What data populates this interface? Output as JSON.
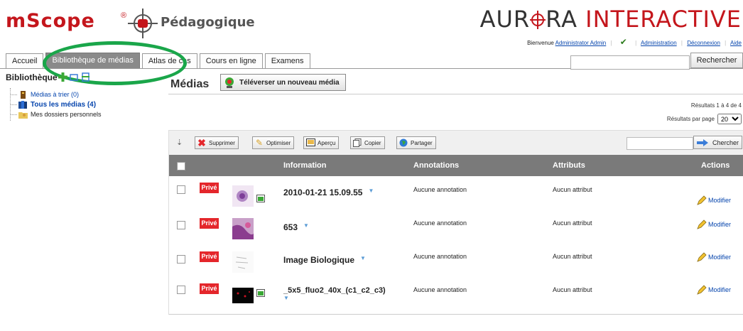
{
  "header": {
    "logo": "mScope",
    "logo_reg": "®",
    "logo_subtitle": "Pédagogique",
    "brand_left": "AUR",
    "brand_mid": "RA",
    "brand_right": "INTERACTIVE",
    "welcome": "Bienvenue",
    "user": "Administrator Admin",
    "admin_link": "Administration",
    "logout_link": "Déconnexion",
    "help_link": "Aide"
  },
  "tabs": [
    {
      "label": "Accueil"
    },
    {
      "label": "Bibliothèque de médias"
    },
    {
      "label": "Atlas de cas"
    },
    {
      "label": "Cours en ligne"
    },
    {
      "label": "Examens"
    }
  ],
  "search_button": "Rechercher",
  "sidebar": {
    "title": "Bibliothèque",
    "items": [
      {
        "label": "Médias à trier (0)"
      },
      {
        "label": "Tous les médias (4)"
      },
      {
        "label": "Mes dossiers personnels"
      }
    ]
  },
  "main": {
    "title": "Médias",
    "upload_label": "Téléverser un nouveau média",
    "results": "Résultats 1 à 4 de 4",
    "per_page_label": "Résultats par page",
    "per_page_value": "20"
  },
  "toolbar": {
    "delete": "Supprimer",
    "optimize": "Optimiser",
    "preview": "Aperçu",
    "copy": "Copier",
    "share": "Partager",
    "search": "Chercher"
  },
  "table": {
    "columns": [
      "Information",
      "Annotations",
      "Attributs",
      "Actions"
    ],
    "rows": [
      {
        "badge": "Privé",
        "info": "2010-01-21 15.09.55",
        "annotations": "Aucune annotation",
        "attributes": "Aucun attribut",
        "action": "Modifier"
      },
      {
        "badge": "Privé",
        "info": "653",
        "annotations": "Aucune annotation",
        "attributes": "Aucun attribut",
        "action": "Modifier"
      },
      {
        "badge": "Privé",
        "info": "Image Biologique",
        "annotations": "Aucune annotation",
        "attributes": "Aucun attribut",
        "action": "Modifier"
      },
      {
        "badge": "Privé",
        "info": "_5x5_fluo2_40x_(c1_c2_c3)",
        "annotations": "Aucune annotation",
        "attributes": "Aucun attribut",
        "action": "Modifier"
      }
    ]
  },
  "colors": {
    "brand_red": "#c4161c",
    "annotation_green": "#1aa64a",
    "table_header": "#7a7a7a",
    "badge_red": "#e4262b",
    "link_blue": "#0645ad"
  }
}
